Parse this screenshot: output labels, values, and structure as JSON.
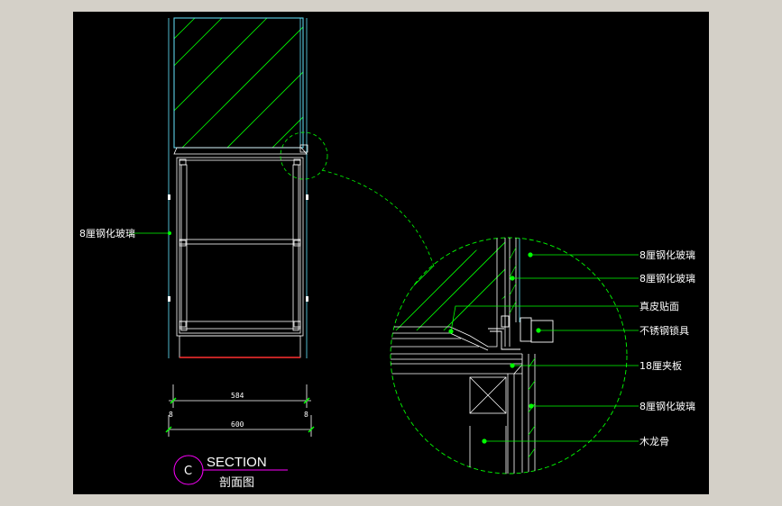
{
  "colors": {
    "background": "#000000",
    "frame": "#d4d0c8",
    "cyan": "#66e6ff",
    "green": "#00ff00",
    "white": "#ffffff",
    "red": "#ff3030",
    "magenta": "#ff00ff"
  },
  "left_view": {
    "glass_label": "8厘钢化玻璃",
    "dim_inner": "584",
    "dim_outer": "600",
    "dim_left": "8",
    "dim_right": "8"
  },
  "detail_labels": [
    "8厘钢化玻璃",
    "8厘钢化玻璃",
    "真皮贴面",
    "不锈钢锁具",
    "18厘夹板",
    "8厘钢化玻璃",
    "木龙骨"
  ],
  "title_block": {
    "letter": "C",
    "title": "SECTION",
    "subtitle": "剖面图"
  }
}
